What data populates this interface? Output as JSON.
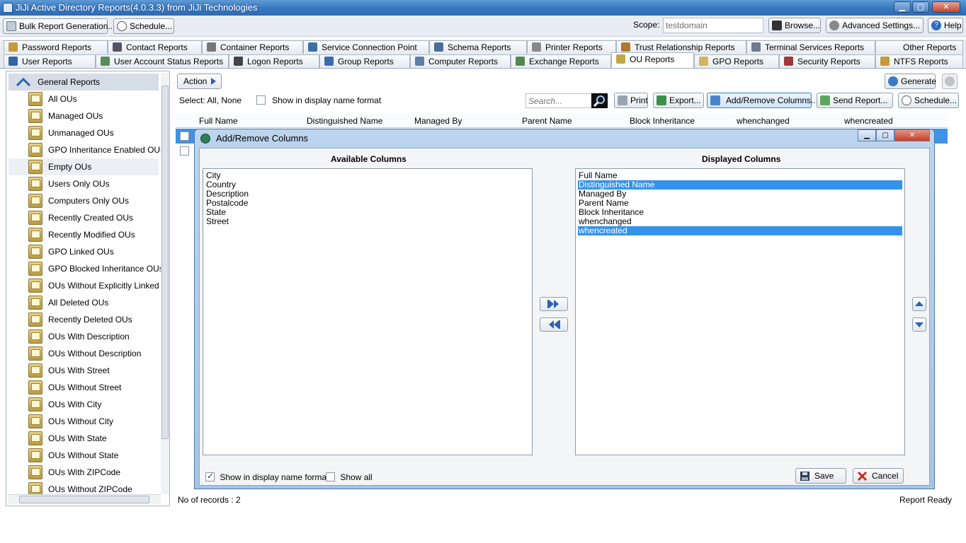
{
  "window": {
    "title": "JiJi Active Directory Reports(4.0.3.3) from JiJi Technologies"
  },
  "toolbar": {
    "bulk_report": "Bulk Report Generation...",
    "schedule": "Schedule...",
    "scope_label": "Scope:",
    "scope_value": "testdomain",
    "browse": "Browse...",
    "advanced_settings": "Advanced Settings...",
    "help": "Help"
  },
  "tabs_top": [
    "Password Reports",
    "Contact Reports",
    "Container Reports",
    "Service Connection Point",
    "Schema Reports",
    "Printer Reports",
    "Trust Relationship Reports",
    "Terminal Services Reports",
    "Other Reports"
  ],
  "tabs_bottom": [
    "User Reports",
    "User Account Status Reports",
    "Logon Reports",
    "Group Reports",
    "Computer Reports",
    "Exchange Reports",
    "OU Reports",
    "GPO Reports",
    "Security Reports",
    "NTFS Reports"
  ],
  "active_tab": "OU Reports",
  "sidebar": {
    "header": "General Reports",
    "items": [
      {
        "label": "All OUs"
      },
      {
        "label": "Managed OUs"
      },
      {
        "label": "Unmanaged OUs"
      },
      {
        "label": "GPO Inheritance Enabled OUs"
      },
      {
        "label": "Empty OUs"
      },
      {
        "label": "Users Only OUs"
      },
      {
        "label": "Computers Only OUs"
      },
      {
        "label": "Recently Created OUs"
      },
      {
        "label": "Recently Modified OUs"
      },
      {
        "label": "GPO Linked OUs"
      },
      {
        "label": "GPO Blocked Inheritance OUs"
      },
      {
        "label": "OUs Without Explicitly Linked GP"
      },
      {
        "label": "All Deleted OUs"
      },
      {
        "label": "Recently Deleted OUs"
      },
      {
        "label": "OUs With Description"
      },
      {
        "label": "OUs Without Description"
      },
      {
        "label": "OUs With Street"
      },
      {
        "label": "OUs Without Street"
      },
      {
        "label": "OUs With City"
      },
      {
        "label": "OUs Without City"
      },
      {
        "label": "OUs With State"
      },
      {
        "label": "OUs Without State"
      },
      {
        "label": "OUs With ZIPCode"
      },
      {
        "label": "OUs Without ZIPCode"
      }
    ],
    "selected": "Empty OUs"
  },
  "main": {
    "action": "Action",
    "select_label": "Select:",
    "select_all": "All,",
    "select_none": "None",
    "display_name_format": "Show in display name format",
    "search_placeholder": "Search...",
    "print": "Print",
    "export": "Export...",
    "add_remove_columns": "Add/Remove Columns...",
    "send_report": "Send Report...",
    "schedule": "Schedule...",
    "generate": "Generate",
    "columns": [
      "Full Name",
      "Distinguished Name",
      "Managed By",
      "Parent Name",
      "Block Inheritance",
      "whenchanged",
      "whencreated"
    ],
    "records_label": "No of records : 2",
    "status": "Report Ready"
  },
  "dialog": {
    "title": "Add/Remove Columns",
    "available_heading": "Available Columns",
    "displayed_heading": "Displayed Columns",
    "available": [
      "City",
      "Country",
      "Description",
      "Postalcode",
      "State",
      "Street"
    ],
    "displayed": [
      {
        "label": "Full Name",
        "selected": false
      },
      {
        "label": "Distinguished Name",
        "selected": true
      },
      {
        "label": "Managed By",
        "selected": false
      },
      {
        "label": "Parent Name",
        "selected": false
      },
      {
        "label": "Block Inheritance",
        "selected": false
      },
      {
        "label": "whenchanged",
        "selected": false
      },
      {
        "label": "whencreated",
        "selected": true
      }
    ],
    "show_display_name": "Show in display name format",
    "show_display_name_checked": true,
    "show_all": "Show all",
    "show_all_checked": false,
    "save": "Save",
    "cancel": "Cancel"
  },
  "colors": {
    "titlebar": "#3b79bf",
    "selection": "#3592ea",
    "dialog_frame": "#a7c4e4"
  }
}
